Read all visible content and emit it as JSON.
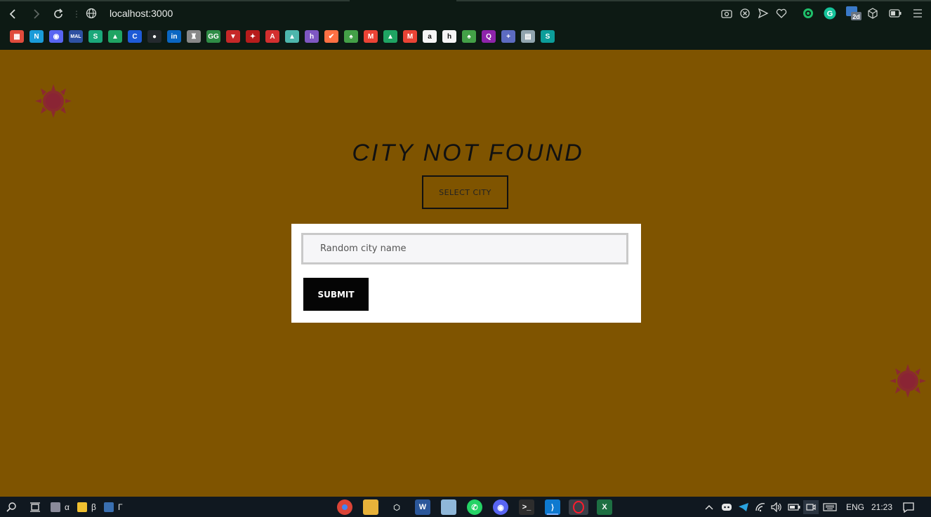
{
  "browser": {
    "url": "localhost:3000",
    "bookmarks": [
      {
        "name": "calendar",
        "color": "#e04b3c",
        "glyph": "▦"
      },
      {
        "name": "N",
        "color": "#1a9bd8",
        "glyph": "N"
      },
      {
        "name": "discord",
        "color": "#5865f2",
        "glyph": "◉"
      },
      {
        "name": "MAL",
        "color": "#2e51a2",
        "glyph": "MAL"
      },
      {
        "name": "S",
        "color": "#1ba87a",
        "glyph": "S"
      },
      {
        "name": "drive",
        "color": "#1fa463",
        "glyph": "▲"
      },
      {
        "name": "C",
        "color": "#1e5ad6",
        "glyph": "C"
      },
      {
        "name": "github",
        "color": "#24292e",
        "glyph": "●"
      },
      {
        "name": "linkedin",
        "color": "#0a66c2",
        "glyph": "in"
      },
      {
        "name": "castle",
        "color": "#888888",
        "glyph": "♜"
      },
      {
        "name": "gfg",
        "color": "#2f8d46",
        "glyph": "GG"
      },
      {
        "name": "mask",
        "color": "#c62828",
        "glyph": "▼"
      },
      {
        "name": "bird",
        "color": "#b71c1c",
        "glyph": "✦"
      },
      {
        "name": "aow",
        "color": "#d32f2f",
        "glyph": "A"
      },
      {
        "name": "mountain",
        "color": "#4db6ac",
        "glyph": "▲"
      },
      {
        "name": "h",
        "color": "#7e57c2",
        "glyph": "h"
      },
      {
        "name": "clock",
        "color": "#ff7043",
        "glyph": "✔"
      },
      {
        "name": "leaf",
        "color": "#43a047",
        "glyph": "♠"
      },
      {
        "name": "gmail",
        "color": "#ea4335",
        "glyph": "M"
      },
      {
        "name": "drive2",
        "color": "#1fa463",
        "glyph": "▲"
      },
      {
        "name": "gmail2",
        "color": "#ea4335",
        "glyph": "M"
      },
      {
        "name": "amazon",
        "color": "#f5f5f5",
        "glyph": "a"
      },
      {
        "name": "hh",
        "color": "#f5f5f5",
        "glyph": "h"
      },
      {
        "name": "leaf2",
        "color": "#43a047",
        "glyph": "♠"
      },
      {
        "name": "q",
        "color": "#8e24aa",
        "glyph": "Q"
      },
      {
        "name": "plus",
        "color": "#5c6bc0",
        "glyph": "+"
      },
      {
        "name": "doc",
        "color": "#90a4ae",
        "glyph": "▤"
      },
      {
        "name": "S2",
        "color": "#0c9d9a",
        "glyph": "S"
      }
    ]
  },
  "page": {
    "title": "CITY NOT FOUND",
    "select_button": "SELECT CITY",
    "input_placeholder": "Random city name",
    "submit_button": "SUBMIT"
  },
  "taskbar": {
    "pinned_labels": [
      "α",
      "β",
      "Γ"
    ],
    "language": "ENG",
    "time": "21:23"
  },
  "colors": {
    "page_background": "#7f5400",
    "sun": "#8b2a2f",
    "panel": "#ffffff",
    "submit_bg": "#050505"
  }
}
